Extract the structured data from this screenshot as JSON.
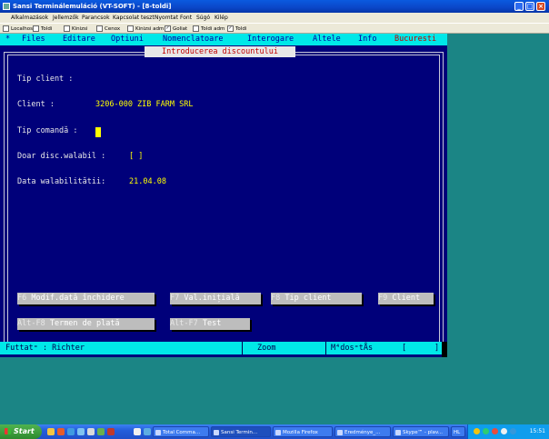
{
  "window": {
    "title": "Sansi Terminálemuláció (VT-SOFT) - [8-toldi]",
    "controls": [
      "_",
      "□",
      "×"
    ]
  },
  "app_menu": [
    "Alkalmazások",
    "Jellemzők",
    "Parancsok",
    "Kapcsolat teszt",
    "Nyomtat",
    "Font",
    "Súgó",
    "Kilép"
  ],
  "toolbar": {
    "items": [
      {
        "label": "Localhost",
        "checked": false
      },
      {
        "label": "Toldi",
        "checked": false
      },
      {
        "label": "Kinizsi",
        "checked": false
      },
      {
        "label": "Cenox",
        "checked": false
      },
      {
        "label": "Kinizsi adm",
        "checked": false
      },
      {
        "label": "Goliat",
        "checked": true
      },
      {
        "label": "Toldi adm",
        "checked": false
      },
      {
        "label": "Toldi",
        "checked": true
      }
    ]
  },
  "terminal": {
    "menu": {
      "star": "*",
      "items": [
        "Files",
        "Editare",
        "Optiuni",
        "Nomenclatoare",
        "Interogare",
        "Altele",
        "Info"
      ],
      "right": "Bucuresti"
    },
    "dialog_title": "Introducerea discountului",
    "fields": {
      "tip_client_label": "Tip client  :",
      "client_label": "Client      :",
      "client_value": "3206-000 ZIB FARM SRL",
      "tip_comanda_label": "Tip comandă :",
      "doar_label": "Doar disc.walabil :",
      "doar_value": "[ ]",
      "data_label": "Data walabilitătii:",
      "data_value": "21.04.08"
    },
    "function_keys": [
      {
        "key": "F6",
        "label": " Modif.dată închidere"
      },
      {
        "key": "F7",
        "label": " Val.inițială"
      },
      {
        "key": "F8",
        "label": " Tip client"
      },
      {
        "key": "F9",
        "label": " Client"
      },
      {
        "key": "Alt-F8",
        "label": " Termen de plată"
      },
      {
        "key": "Alt-F7",
        "label": " Test"
      }
    ],
    "status": {
      "user": "Futtat⁼  : Richter",
      "mode": "Zoom",
      "mod": "M⁴dos⁼tÅs",
      "bracket_open": "[",
      "bracket_close": "]"
    }
  },
  "taskbar": {
    "start": "Start",
    "tasks": [
      "Total Comma...",
      "Sansi Termin...",
      "Mozilla Firefox",
      "Eredménye_...",
      "Skype™ - plav...",
      "HL"
    ],
    "clock": "15:51"
  }
}
